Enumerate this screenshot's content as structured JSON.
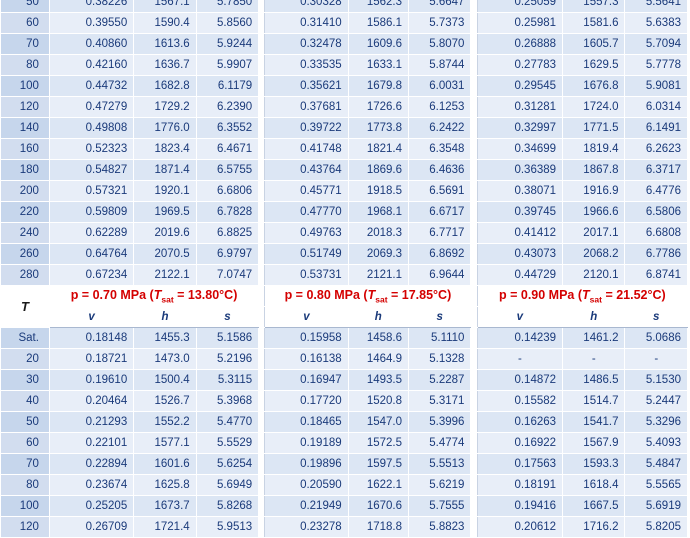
{
  "column_headers": {
    "temperature": "T",
    "groups": [
      {
        "p": "p = 0.70 MPa",
        "tsat_val": " = 13.80°C)"
      },
      {
        "p": "p = 0.80 MPa",
        "tsat_val": " = 17.85°C)"
      },
      {
        "p": "p = 0.90 MPa",
        "tsat_val": " = 21.52°C)"
      }
    ],
    "tsat_T": "T",
    "tsat_sub": "sat",
    "sub": [
      "v",
      "h",
      "s"
    ]
  },
  "upper_rows": [
    {
      "T": "50",
      "v": [
        [
          "0.38226",
          "1567.1",
          "5.7850"
        ],
        [
          "0.30328",
          "1562.3",
          "5.6647"
        ],
        [
          "0.25059",
          "1557.3",
          "5.5641"
        ]
      ]
    },
    {
      "T": "60",
      "v": [
        [
          "0.39550",
          "1590.4",
          "5.8560"
        ],
        [
          "0.31410",
          "1586.1",
          "5.7373"
        ],
        [
          "0.25981",
          "1581.6",
          "5.6383"
        ]
      ]
    },
    {
      "T": "70",
      "v": [
        [
          "0.40860",
          "1613.6",
          "5.9244"
        ],
        [
          "0.32478",
          "1609.6",
          "5.8070"
        ],
        [
          "0.26888",
          "1605.7",
          "5.7094"
        ]
      ]
    },
    {
      "T": "80",
      "v": [
        [
          "0.42160",
          "1636.7",
          "5.9907"
        ],
        [
          "0.33535",
          "1633.1",
          "5.8744"
        ],
        [
          "0.27783",
          "1629.5",
          "5.7778"
        ]
      ]
    },
    {
      "T": "100",
      "v": [
        [
          "0.44732",
          "1682.8",
          "6.1179"
        ],
        [
          "0.35621",
          "1679.8",
          "6.0031"
        ],
        [
          "0.29545",
          "1676.8",
          "5.9081"
        ]
      ]
    },
    {
      "T": "120",
      "v": [
        [
          "0.47279",
          "1729.2",
          "6.2390"
        ],
        [
          "0.37681",
          "1726.6",
          "6.1253"
        ],
        [
          "0.31281",
          "1724.0",
          "6.0314"
        ]
      ]
    },
    {
      "T": "140",
      "v": [
        [
          "0.49808",
          "1776.0",
          "6.3552"
        ],
        [
          "0.39722",
          "1773.8",
          "6.2422"
        ],
        [
          "0.32997",
          "1771.5",
          "6.1491"
        ]
      ]
    },
    {
      "T": "160",
      "v": [
        [
          "0.52323",
          "1823.4",
          "6.4671"
        ],
        [
          "0.41748",
          "1821.4",
          "6.3548"
        ],
        [
          "0.34699",
          "1819.4",
          "6.2623"
        ]
      ]
    },
    {
      "T": "180",
      "v": [
        [
          "0.54827",
          "1871.4",
          "6.5755"
        ],
        [
          "0.43764",
          "1869.6",
          "6.4636"
        ],
        [
          "0.36389",
          "1867.8",
          "6.3717"
        ]
      ]
    },
    {
      "T": "200",
      "v": [
        [
          "0.57321",
          "1920.1",
          "6.6806"
        ],
        [
          "0.45771",
          "1918.5",
          "6.5691"
        ],
        [
          "0.38071",
          "1916.9",
          "6.4776"
        ]
      ]
    },
    {
      "T": "220",
      "v": [
        [
          "0.59809",
          "1969.5",
          "6.7828"
        ],
        [
          "0.47770",
          "1968.1",
          "6.6717"
        ],
        [
          "0.39745",
          "1966.6",
          "6.5806"
        ]
      ]
    },
    {
      "T": "240",
      "v": [
        [
          "0.62289",
          "2019.6",
          "6.8825"
        ],
        [
          "0.49763",
          "2018.3",
          "6.7717"
        ],
        [
          "0.41412",
          "2017.1",
          "6.6808"
        ]
      ]
    },
    {
      "T": "260",
      "v": [
        [
          "0.64764",
          "2070.5",
          "6.9797"
        ],
        [
          "0.51749",
          "2069.3",
          "6.8692"
        ],
        [
          "0.43073",
          "2068.2",
          "6.7786"
        ]
      ]
    },
    {
      "T": "280",
      "v": [
        [
          "0.67234",
          "2122.1",
          "7.0747"
        ],
        [
          "0.53731",
          "2121.1",
          "6.9644"
        ],
        [
          "0.44729",
          "2120.1",
          "6.8741"
        ]
      ]
    }
  ],
  "lower_rows": [
    {
      "T": "Sat.",
      "v": [
        [
          "0.18148",
          "1455.3",
          "5.1586"
        ],
        [
          "0.15958",
          "1458.6",
          "5.1110"
        ],
        [
          "0.14239",
          "1461.2",
          "5.0686"
        ]
      ]
    },
    {
      "T": "20",
      "v": [
        [
          "0.18721",
          "1473.0",
          "5.2196"
        ],
        [
          "0.16138",
          "1464.9",
          "5.1328"
        ],
        [
          "-",
          "-",
          "-"
        ]
      ]
    },
    {
      "T": "30",
      "v": [
        [
          "0.19610",
          "1500.4",
          "5.3115"
        ],
        [
          "0.16947",
          "1493.5",
          "5.2287"
        ],
        [
          "0.14872",
          "1486.5",
          "5.1530"
        ]
      ]
    },
    {
      "T": "40",
      "v": [
        [
          "0.20464",
          "1526.7",
          "5.3968"
        ],
        [
          "0.17720",
          "1520.8",
          "5.3171"
        ],
        [
          "0.15582",
          "1514.7",
          "5.2447"
        ]
      ]
    },
    {
      "T": "50",
      "v": [
        [
          "0.21293",
          "1552.2",
          "5.4770"
        ],
        [
          "0.18465",
          "1547.0",
          "5.3996"
        ],
        [
          "0.16263",
          "1541.7",
          "5.3296"
        ]
      ]
    },
    {
      "T": "60",
      "v": [
        [
          "0.22101",
          "1577.1",
          "5.5529"
        ],
        [
          "0.19189",
          "1572.5",
          "5.4774"
        ],
        [
          "0.16922",
          "1567.9",
          "5.4093"
        ]
      ]
    },
    {
      "T": "70",
      "v": [
        [
          "0.22894",
          "1601.6",
          "5.6254"
        ],
        [
          "0.19896",
          "1597.5",
          "5.5513"
        ],
        [
          "0.17563",
          "1593.3",
          "5.4847"
        ]
      ]
    },
    {
      "T": "80",
      "v": [
        [
          "0.23674",
          "1625.8",
          "5.6949"
        ],
        [
          "0.20590",
          "1622.1",
          "5.6219"
        ],
        [
          "0.18191",
          "1618.4",
          "5.5565"
        ]
      ]
    },
    {
      "T": "100",
      "v": [
        [
          "0.25205",
          "1673.7",
          "5.8268"
        ],
        [
          "0.21949",
          "1670.6",
          "5.7555"
        ],
        [
          "0.19416",
          "1667.5",
          "5.6919"
        ]
      ]
    },
    {
      "T": "120",
      "v": [
        [
          "0.26709",
          "1721.4",
          "5.9513"
        ],
        [
          "0.23278",
          "1718.8",
          "5.8823"
        ],
        [
          "0.20612",
          "1716.2",
          "5.8205"
        ]
      ]
    }
  ]
}
